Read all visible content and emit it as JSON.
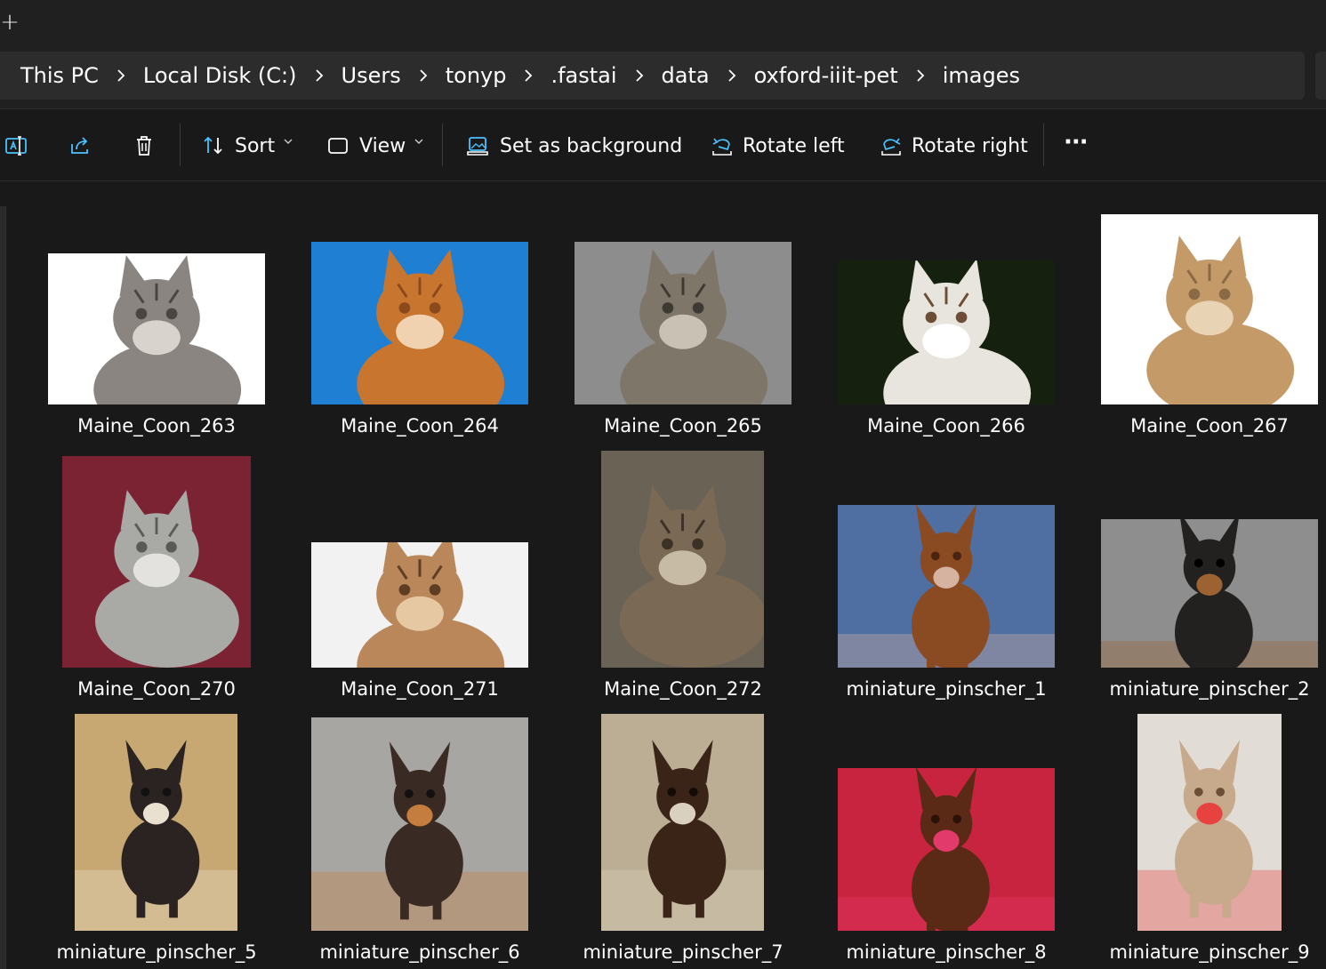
{
  "tabstrip": {
    "new_tab_symbol": "+"
  },
  "breadcrumb": [
    "This PC",
    "Local Disk (C:)",
    "Users",
    "tonyp",
    ".fastai",
    "data",
    "oxford-iiit-pet",
    "images"
  ],
  "toolbar": {
    "rename_icon": "rename-icon",
    "share_icon": "share-icon",
    "delete_icon": "delete-icon",
    "sort_label": "Sort",
    "view_label": "View",
    "set_background_label": "Set as background",
    "rotate_left_label": "Rotate left",
    "rotate_right_label": "Rotate right",
    "more_label": "···"
  },
  "files": [
    {
      "name": "Maine_Coon_263",
      "subject": "cat"
    },
    {
      "name": "Maine_Coon_264",
      "subject": "cat"
    },
    {
      "name": "Maine_Coon_265",
      "subject": "cat"
    },
    {
      "name": "Maine_Coon_266",
      "subject": "cat"
    },
    {
      "name": "Maine_Coon_267",
      "subject": "cat"
    },
    {
      "name": "Maine_Coon_270",
      "subject": "cat"
    },
    {
      "name": "Maine_Coon_271",
      "subject": "cat"
    },
    {
      "name": "Maine_Coon_272",
      "subject": "cat"
    },
    {
      "name": "miniature_pinscher_1",
      "subject": "dog"
    },
    {
      "name": "miniature_pinscher_2",
      "subject": "dog"
    },
    {
      "name": "miniature_pinscher_5",
      "subject": "dog"
    },
    {
      "name": "miniature_pinscher_6",
      "subject": "dog"
    },
    {
      "name": "miniature_pinscher_7",
      "subject": "dog"
    },
    {
      "name": "miniature_pinscher_8",
      "subject": "dog"
    },
    {
      "name": "miniature_pinscher_9",
      "subject": "dog"
    }
  ],
  "colors": {
    "background": "#191919",
    "chrome": "#202020",
    "address_field": "#2c2c2c",
    "accent": "#4cc2ff"
  }
}
